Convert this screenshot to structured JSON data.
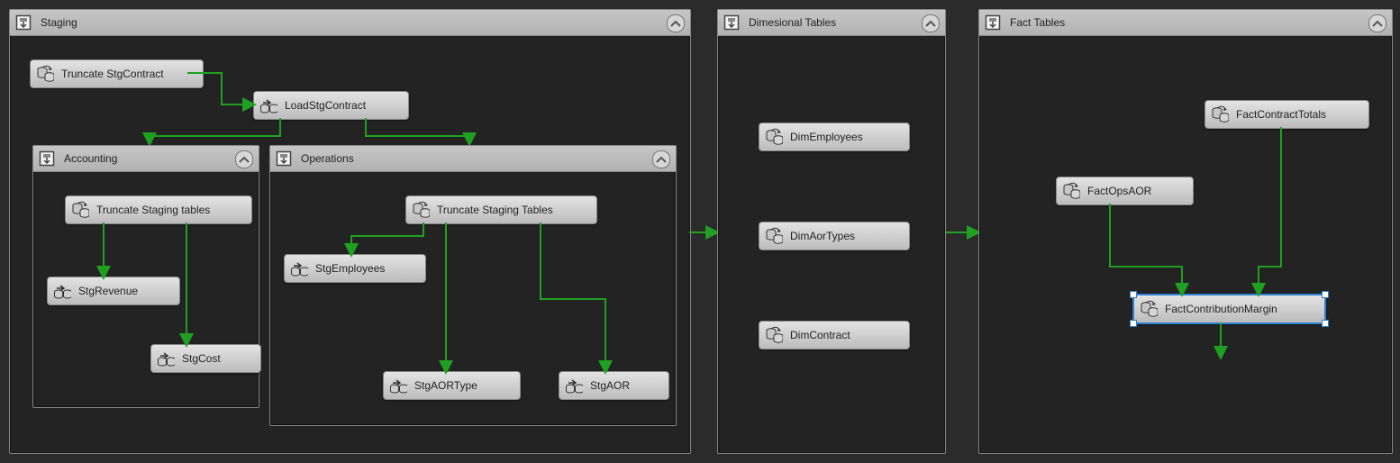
{
  "colors": {
    "success": "#20a020",
    "selection": "#2f7fd0"
  },
  "containers": {
    "staging": {
      "title": "Staging"
    },
    "accounting": {
      "title": "Accounting"
    },
    "operations": {
      "title": "Operations"
    },
    "dims": {
      "title": "Dimesional Tables"
    },
    "facts": {
      "title": "Fact Tables"
    }
  },
  "tasks": {
    "truncateStgContract": {
      "label": "Truncate StgContract",
      "kind": "sql"
    },
    "loadStgContract": {
      "label": "LoadStgContract",
      "kind": "dataflow"
    },
    "acct_truncateStaging": {
      "label": "Truncate Staging tables",
      "kind": "sql"
    },
    "acct_stgRevenue": {
      "label": "StgRevenue",
      "kind": "dataflow"
    },
    "acct_stgCost": {
      "label": "StgCost",
      "kind": "dataflow"
    },
    "ops_truncateStaging": {
      "label": "Truncate Staging Tables",
      "kind": "sql"
    },
    "ops_stgEmployees": {
      "label": "StgEmployees",
      "kind": "dataflow"
    },
    "ops_stgAORType": {
      "label": "StgAORType",
      "kind": "dataflow"
    },
    "ops_stgAOR": {
      "label": "StgAOR",
      "kind": "dataflow"
    },
    "dimEmployees": {
      "label": "DimEmployees",
      "kind": "sql"
    },
    "dimAorTypes": {
      "label": "DimAorTypes",
      "kind": "sql"
    },
    "dimContract": {
      "label": "DimContract",
      "kind": "sql"
    },
    "factContractTotals": {
      "label": "FactContractTotals",
      "kind": "sql"
    },
    "factOpsAOR": {
      "label": "FactOpsAOR",
      "kind": "sql"
    },
    "factContributionMargin": {
      "label": "FactContributionMargin",
      "kind": "sql",
      "selected": true
    }
  }
}
